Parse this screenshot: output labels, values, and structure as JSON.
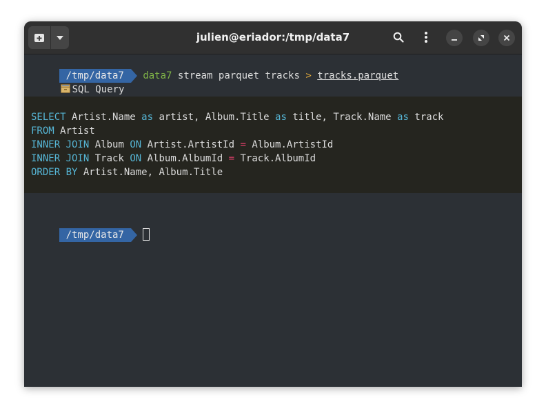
{
  "window": {
    "title": "julien@eriador:/tmp/data7"
  },
  "titlebar": {
    "new_tab_icon": "new-tab-icon",
    "menu_icon": "chevron-down-icon",
    "search_icon": "search-icon",
    "kebab_icon": "kebab-menu-icon",
    "minimize_icon": "minimize-icon",
    "maximize_icon": "maximize-icon",
    "close_icon": "close-icon"
  },
  "terminal": {
    "prompt_path": "/tmp/data7",
    "command": {
      "program": "data7",
      "args": " stream parquet tracks ",
      "redirect": ">",
      "target": "tracks.parquet"
    },
    "output_header": {
      "icon": "card-file-box-icon",
      "label": "SQL Query"
    },
    "sql_lines": [
      [
        {
          "t": "SELECT",
          "k": "kw"
        },
        {
          "t": " Artist.Name ",
          "k": "txt"
        },
        {
          "t": "as",
          "k": "kw"
        },
        {
          "t": " artist, Album.Title ",
          "k": "txt"
        },
        {
          "t": "as",
          "k": "kw"
        },
        {
          "t": " title, Track.Name ",
          "k": "txt"
        },
        {
          "t": "as",
          "k": "kw"
        },
        {
          "t": " track",
          "k": "txt"
        }
      ],
      [
        {
          "t": "FROM",
          "k": "kw"
        },
        {
          "t": " Artist",
          "k": "txt"
        }
      ],
      [
        {
          "t": "INNER JOIN",
          "k": "kw"
        },
        {
          "t": " Album ",
          "k": "txt"
        },
        {
          "t": "ON",
          "k": "kw"
        },
        {
          "t": " Artist.ArtistId ",
          "k": "txt"
        },
        {
          "t": "=",
          "k": "op"
        },
        {
          "t": " Album.ArtistId",
          "k": "txt"
        }
      ],
      [
        {
          "t": "INNER JOIN",
          "k": "kw"
        },
        {
          "t": " Track ",
          "k": "txt"
        },
        {
          "t": "ON",
          "k": "kw"
        },
        {
          "t": " Album.AlbumId ",
          "k": "txt"
        },
        {
          "t": "=",
          "k": "op"
        },
        {
          "t": " Track.AlbumId",
          "k": "txt"
        }
      ],
      [
        {
          "t": "ORDER BY",
          "k": "kw"
        },
        {
          "t": " Artist.Name, Album.Title",
          "k": "txt"
        }
      ]
    ],
    "second_prompt_path": "/tmp/data7"
  },
  "colors": {
    "prompt_bg": "#3465a4",
    "keyword": "#56b6d6",
    "operator": "#e0406a",
    "program": "#7fb347",
    "redirect": "#e0a93c",
    "terminal_bg": "#2c3035",
    "sql_block_bg": "#25251f"
  }
}
